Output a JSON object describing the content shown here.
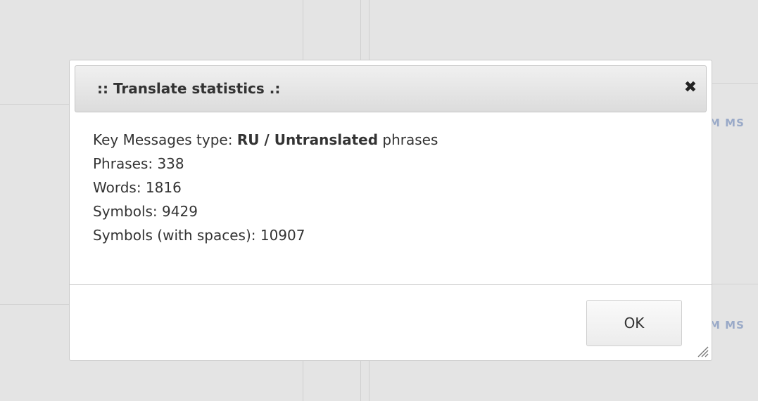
{
  "dialog": {
    "title": ":: Translate statistics .:",
    "close_glyph": "✖",
    "line1": {
      "prefix": "Key Messages type: ",
      "bold": "RU / Untranslated",
      "suffix": " phrases"
    },
    "line2": "Phrases: 338",
    "line3": "Words: 1816",
    "line4": "Symbols: 9429",
    "line5": "Symbols (with spaces): 10907",
    "ok_label": "OK"
  },
  "background": {
    "links_row1": "M  MS",
    "links_row2": "M  MS"
  },
  "colors": {
    "page_background": "#e4e4e4",
    "link_color": "#9aaac8",
    "dialog_background": "#ffffff"
  }
}
